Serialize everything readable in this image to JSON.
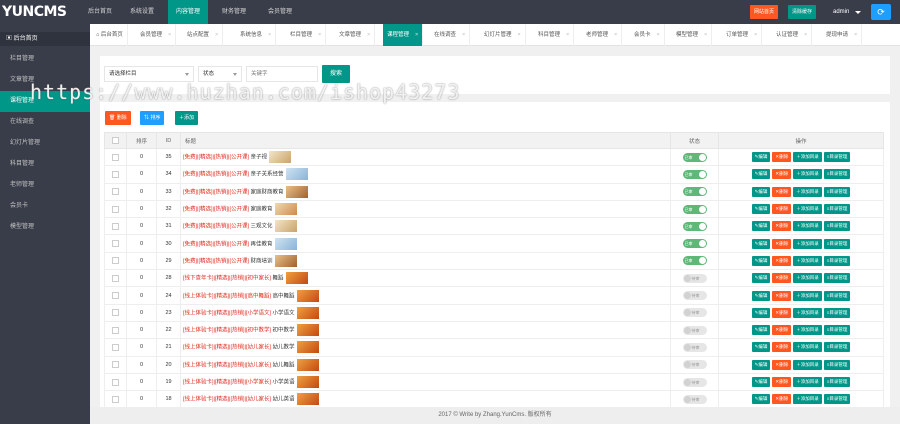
{
  "app": {
    "logo": "YUNCMS"
  },
  "topnav": [
    "后台首页",
    "系统设置",
    "内容管理",
    "财务管理",
    "会员管理"
  ],
  "topbuttons": {
    "site": "网站首页",
    "clear": "清除缓存",
    "user": "admin"
  },
  "sidebar": {
    "header": "后台首页",
    "items": [
      "栏目管理",
      "文章管理",
      "课程管理",
      "在线调查",
      "幻灯片管理",
      "科目管理",
      "老师管理",
      "会员卡",
      "模型管理"
    ]
  },
  "tabs": [
    "后台首页",
    "会员管理",
    "站点配置",
    "系统信息",
    "栏目管理",
    "文章管理",
    "课程管理",
    "在线调查",
    "幻灯片管理",
    "科目管理",
    "老师管理",
    "会员卡",
    "模型管理",
    "订单管理",
    "认证管理",
    "提现申请"
  ],
  "filters": {
    "category": "请选择栏目",
    "status": "状态",
    "keyword_placeholder": "关键字",
    "search": "搜索"
  },
  "actions": {
    "delete": "删除",
    "sort": "排序",
    "add": "添加"
  },
  "table": {
    "headers": [
      "",
      "排序",
      "ID",
      "标题",
      "状态",
      "操作"
    ],
    "ops": [
      "编辑",
      "删除",
      "添加目录",
      "目录管理"
    ],
    "rows": [
      {
        "sort": "0",
        "id": "35",
        "tags": "[免费]|[精选]|[热销]|[公开课]",
        "name": "亲子视",
        "status": "已审",
        "on": true,
        "thumb": "a"
      },
      {
        "sort": "0",
        "id": "34",
        "tags": "[免费]|[精选]|[热销]|[公开课]",
        "name": "亲子关系经营",
        "status": "已审",
        "on": true,
        "thumb": "b"
      },
      {
        "sort": "0",
        "id": "33",
        "tags": "[免费]|[精选]|[热销]|[公开课]",
        "name": "家庭财商教育",
        "status": "已审",
        "on": true,
        "thumb": "c"
      },
      {
        "sort": "0",
        "id": "32",
        "tags": "[免费]|[精选]|[热销]|[公开课]",
        "name": "家庭教育",
        "status": "已审",
        "on": true,
        "thumb": "d"
      },
      {
        "sort": "0",
        "id": "31",
        "tags": "[免费]|[精选]|[热销]|[公开课]",
        "name": "三观文化",
        "status": "已审",
        "on": true,
        "thumb": "a"
      },
      {
        "sort": "0",
        "id": "30",
        "tags": "[免费]|[精选]|[热销]|[公开课]",
        "name": "再佳教育",
        "status": "已审",
        "on": true,
        "thumb": "b"
      },
      {
        "sort": "0",
        "id": "29",
        "tags": "[免费]|[精选]|[热销]|[公开课]",
        "name": "财商培训",
        "status": "已审",
        "on": true,
        "thumb": "c"
      },
      {
        "sort": "0",
        "id": "28",
        "tags": "[线下查年卡]|[精选]|[热销]|[初中家长]",
        "name": "舞蹈",
        "status": "待审",
        "on": false,
        "thumb": "e"
      },
      {
        "sort": "0",
        "id": "24",
        "tags": "[线上体验卡]|[精选]|[热销]|[高中舞蹈]",
        "name": "高中舞蹈",
        "status": "待审",
        "on": false,
        "thumb": "e"
      },
      {
        "sort": "0",
        "id": "23",
        "tags": "[线上体验卡]|[精选]|[热销]|[小学语文]",
        "name": "小学语文",
        "status": "待审",
        "on": false,
        "thumb": "e"
      },
      {
        "sort": "0",
        "id": "22",
        "tags": "[线上体验卡]|[精选]|[热销]|[初中数学]",
        "name": "初中数学",
        "status": "待审",
        "on": false,
        "thumb": "e"
      },
      {
        "sort": "0",
        "id": "21",
        "tags": "[线上体验卡]|[精选]|[热销]|[幼儿家长]",
        "name": "幼儿数学",
        "status": "待审",
        "on": false,
        "thumb": "e"
      },
      {
        "sort": "0",
        "id": "20",
        "tags": "[线上体验卡]|[精选]|[热销]|[幼儿家长]",
        "name": "幼儿舞蹈",
        "status": "待审",
        "on": false,
        "thumb": "e"
      },
      {
        "sort": "0",
        "id": "19",
        "tags": "[线上体验卡]|[精选]|[热销]|[小学家长]",
        "name": "小学英语",
        "status": "待审",
        "on": false,
        "thumb": "e"
      },
      {
        "sort": "0",
        "id": "18",
        "tags": "[线上体验卡]|[精选]|[热销]|[幼儿家长]",
        "name": "幼儿英语",
        "status": "待审",
        "on": false,
        "thumb": "e"
      }
    ]
  },
  "footer": "2017 © Write by Zhang.YunCms. 版权所有",
  "watermark": "https://www.huzhan.com/ishop43273",
  "colors": {
    "primary": "#009688",
    "dark": "#393d49",
    "orange": "#ff5722",
    "blue": "#1e9fff",
    "red": "#e0291b"
  }
}
